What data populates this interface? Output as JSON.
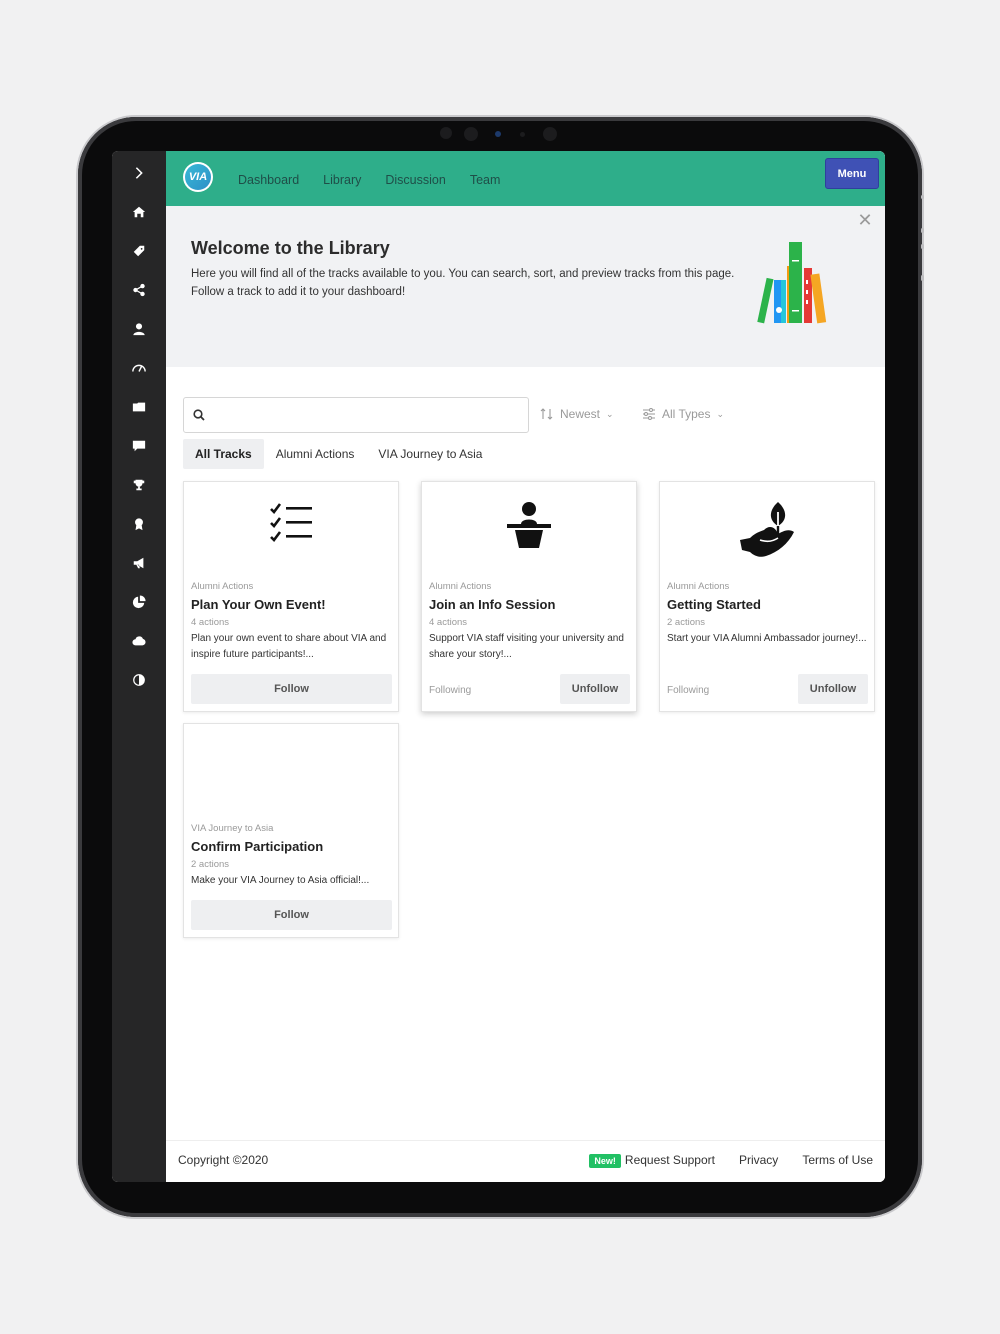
{
  "nav": {
    "items": [
      "Dashboard",
      "Library",
      "Discussion",
      "Team"
    ],
    "menu_label": "Menu",
    "logo_text": "VIA"
  },
  "sidebar": {
    "icons": [
      "chevron-right-icon",
      "home-icon",
      "tag-icon",
      "share-icon",
      "user-icon",
      "gauge-icon",
      "folder-icon",
      "chat-icon",
      "trophy-icon",
      "award-icon",
      "megaphone-icon",
      "pie-chart-icon",
      "cloud-icon",
      "toggle-icon"
    ]
  },
  "banner": {
    "title": "Welcome to the Library",
    "text": "Here you will find all of the tracks available to you. You can search, sort, and preview tracks from this page. Follow a track to add it to your dashboard!",
    "close": "✕"
  },
  "search": {
    "placeholder": "",
    "value": ""
  },
  "sort": {
    "label": "Newest"
  },
  "filter": {
    "label": "All Types"
  },
  "tabs": [
    "All Tracks",
    "Alumni Actions",
    "VIA Journey to Asia"
  ],
  "cards": [
    {
      "category": "Alumni Actions",
      "title": "Plan Your Own Event!",
      "count": "4 actions",
      "desc": "Plan your own event to share about VIA and inspire future participants!...",
      "button": "Follow"
    },
    {
      "category": "Alumni Actions",
      "title": "Join an Info Session",
      "count": "4 actions",
      "desc": "Support VIA staff visiting your university and share your story!...",
      "status": "Following",
      "button": "Unfollow"
    },
    {
      "category": "Alumni Actions",
      "title": "Getting Started",
      "count": "2 actions",
      "desc": "Start your VIA Alumni Ambassador journey!...",
      "status": "Following",
      "button": "Unfollow"
    },
    {
      "category": "VIA Journey to Asia",
      "title": "Confirm Participation",
      "count": "2 actions",
      "desc": "Make your VIA Journey to Asia official!...",
      "button": "Follow"
    }
  ],
  "footer": {
    "copyright": "Copyright ©2020",
    "badge": "New!",
    "support": "Request Support",
    "privacy": "Privacy",
    "terms": "Terms of Use"
  },
  "colors": {
    "topbar": "#2eae8a",
    "menu_button": "#3f51b5",
    "sidebar": "#262627",
    "badge": "#21c064"
  }
}
